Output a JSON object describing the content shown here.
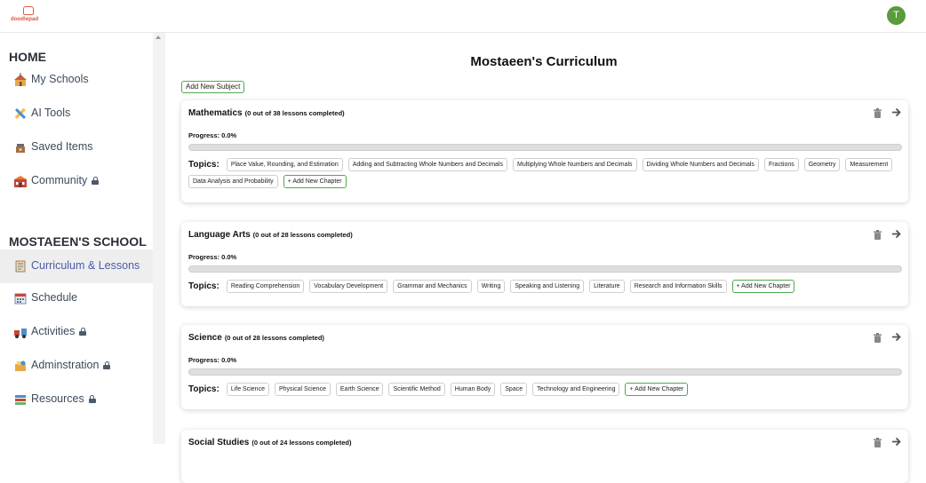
{
  "app": {
    "logo_text": "doodlepad",
    "avatar_initial": "T"
  },
  "sidebar": {
    "sections": [
      {
        "heading": "HOME",
        "items": [
          {
            "label": "My Schools",
            "icon": "school-icon",
            "locked": false
          },
          {
            "label": "AI Tools",
            "icon": "pencil-ruler-icon",
            "locked": false
          },
          {
            "label": "Saved Items",
            "icon": "saved-icon",
            "locked": false
          },
          {
            "label": "Community",
            "icon": "community-icon",
            "locked": true
          }
        ]
      },
      {
        "heading": "MOSTAEEN'S SCHOOL",
        "items": [
          {
            "label": "Curriculum & Lessons",
            "icon": "notebook-icon",
            "locked": false,
            "active": true
          },
          {
            "label": "Schedule",
            "icon": "calendar-icon",
            "locked": false
          },
          {
            "label": "Activities",
            "icon": "activities-icon",
            "locked": true
          },
          {
            "label": "Adminstration",
            "icon": "admin-icon",
            "locked": true
          },
          {
            "label": "Resources",
            "icon": "books-icon",
            "locked": true
          }
        ]
      }
    ]
  },
  "main": {
    "title": "Mostaeen's Curriculum",
    "add_subject_label": "Add New Subject",
    "topics_label": "Topics:",
    "progress_prefix": "Progress:",
    "add_chapter_label": "+ Add New Chapter",
    "subjects": [
      {
        "name": "Mathematics",
        "count": "(0 out of 38 lessons completed)",
        "progress": "0.0%",
        "progress_value": 0,
        "topics": [
          "Place Value, Rounding, and Estimation",
          "Adding and Subtracting Whole Numbers and Decimals",
          "Multiplying Whole Numbers and Decimals",
          "Dividing Whole Numbers and Decimals",
          "Fractions",
          "Geometry",
          "Measurement",
          "Data Analysis and Probability"
        ]
      },
      {
        "name": "Language Arts",
        "count": "(0 out of 28 lessons completed)",
        "progress": "0.0%",
        "progress_value": 0,
        "topics": [
          "Reading Comprehension",
          "Vocabulary Development",
          "Grammar and Mechanics",
          "Writing",
          "Speaking and Listening",
          "Literature",
          "Research and Information Skills"
        ]
      },
      {
        "name": "Science",
        "count": "(0 out of 28 lessons completed)",
        "progress": "0.0%",
        "progress_value": 0,
        "topics": [
          "Life Science",
          "Physical Science",
          "Earth Science",
          "Scientific Method",
          "Human Body",
          "Space",
          "Technology and Engineering"
        ]
      },
      {
        "name": "Social Studies",
        "count": "(0 out of 24 lessons completed)",
        "progress": "",
        "progress_value": 0,
        "topics": []
      }
    ]
  }
}
